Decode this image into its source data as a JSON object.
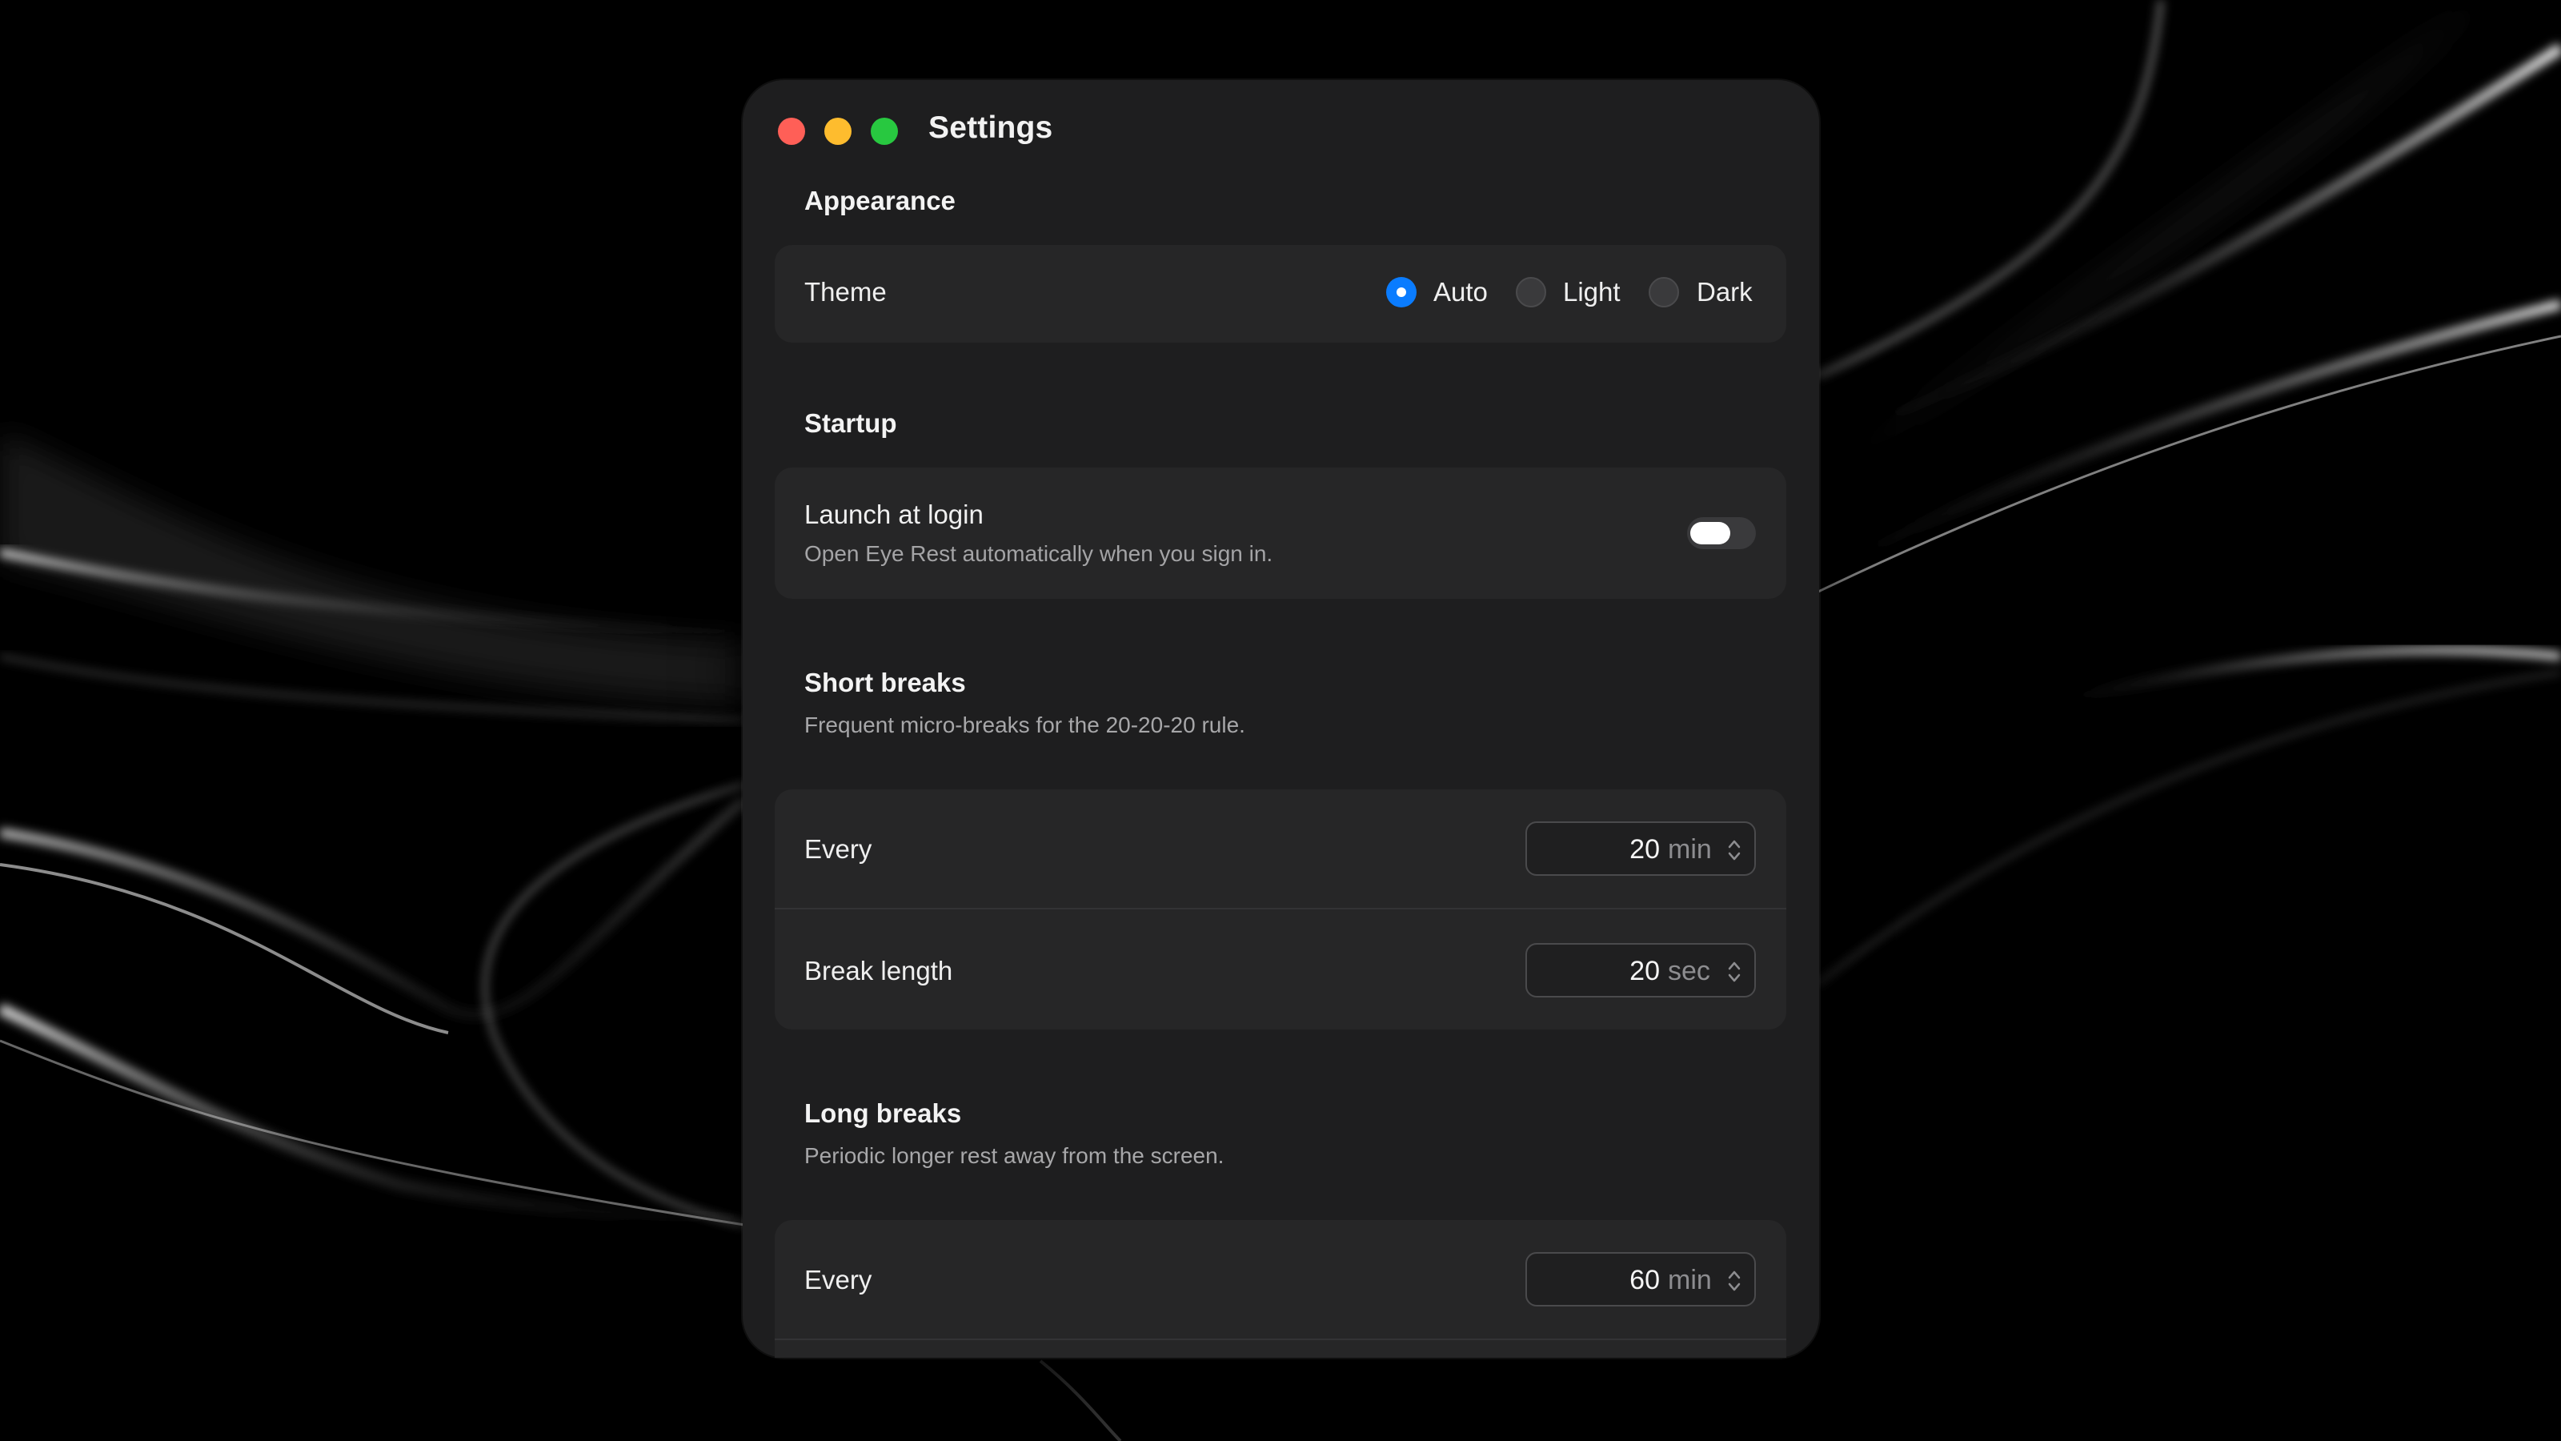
{
  "window": {
    "title": "Settings"
  },
  "appearance": {
    "heading": "Appearance",
    "theme_label": "Theme",
    "options": [
      {
        "label": "Auto",
        "selected": true
      },
      {
        "label": "Light",
        "selected": false
      },
      {
        "label": "Dark",
        "selected": false
      }
    ]
  },
  "startup": {
    "heading": "Startup",
    "launch_label": "Launch at login",
    "launch_sub": "Open Eye Rest automatically when you sign in.",
    "launch_enabled": false
  },
  "short_breaks": {
    "heading": "Short breaks",
    "sub": "Frequent micro-breaks for the 20-20-20 rule.",
    "every_label": "Every",
    "every_value": "20",
    "every_unit": "min",
    "length_label": "Break length",
    "length_value": "20",
    "length_unit": "sec"
  },
  "long_breaks": {
    "heading": "Long breaks",
    "sub": "Periodic longer rest away from the screen.",
    "every_label": "Every",
    "every_value": "60",
    "every_unit": "min"
  },
  "colors": {
    "accent": "#0a7cff",
    "close": "#ff5f57",
    "minimize": "#febc2e",
    "zoom": "#28c840"
  },
  "icons": {
    "stepper": "chevron-up-down-icon"
  }
}
